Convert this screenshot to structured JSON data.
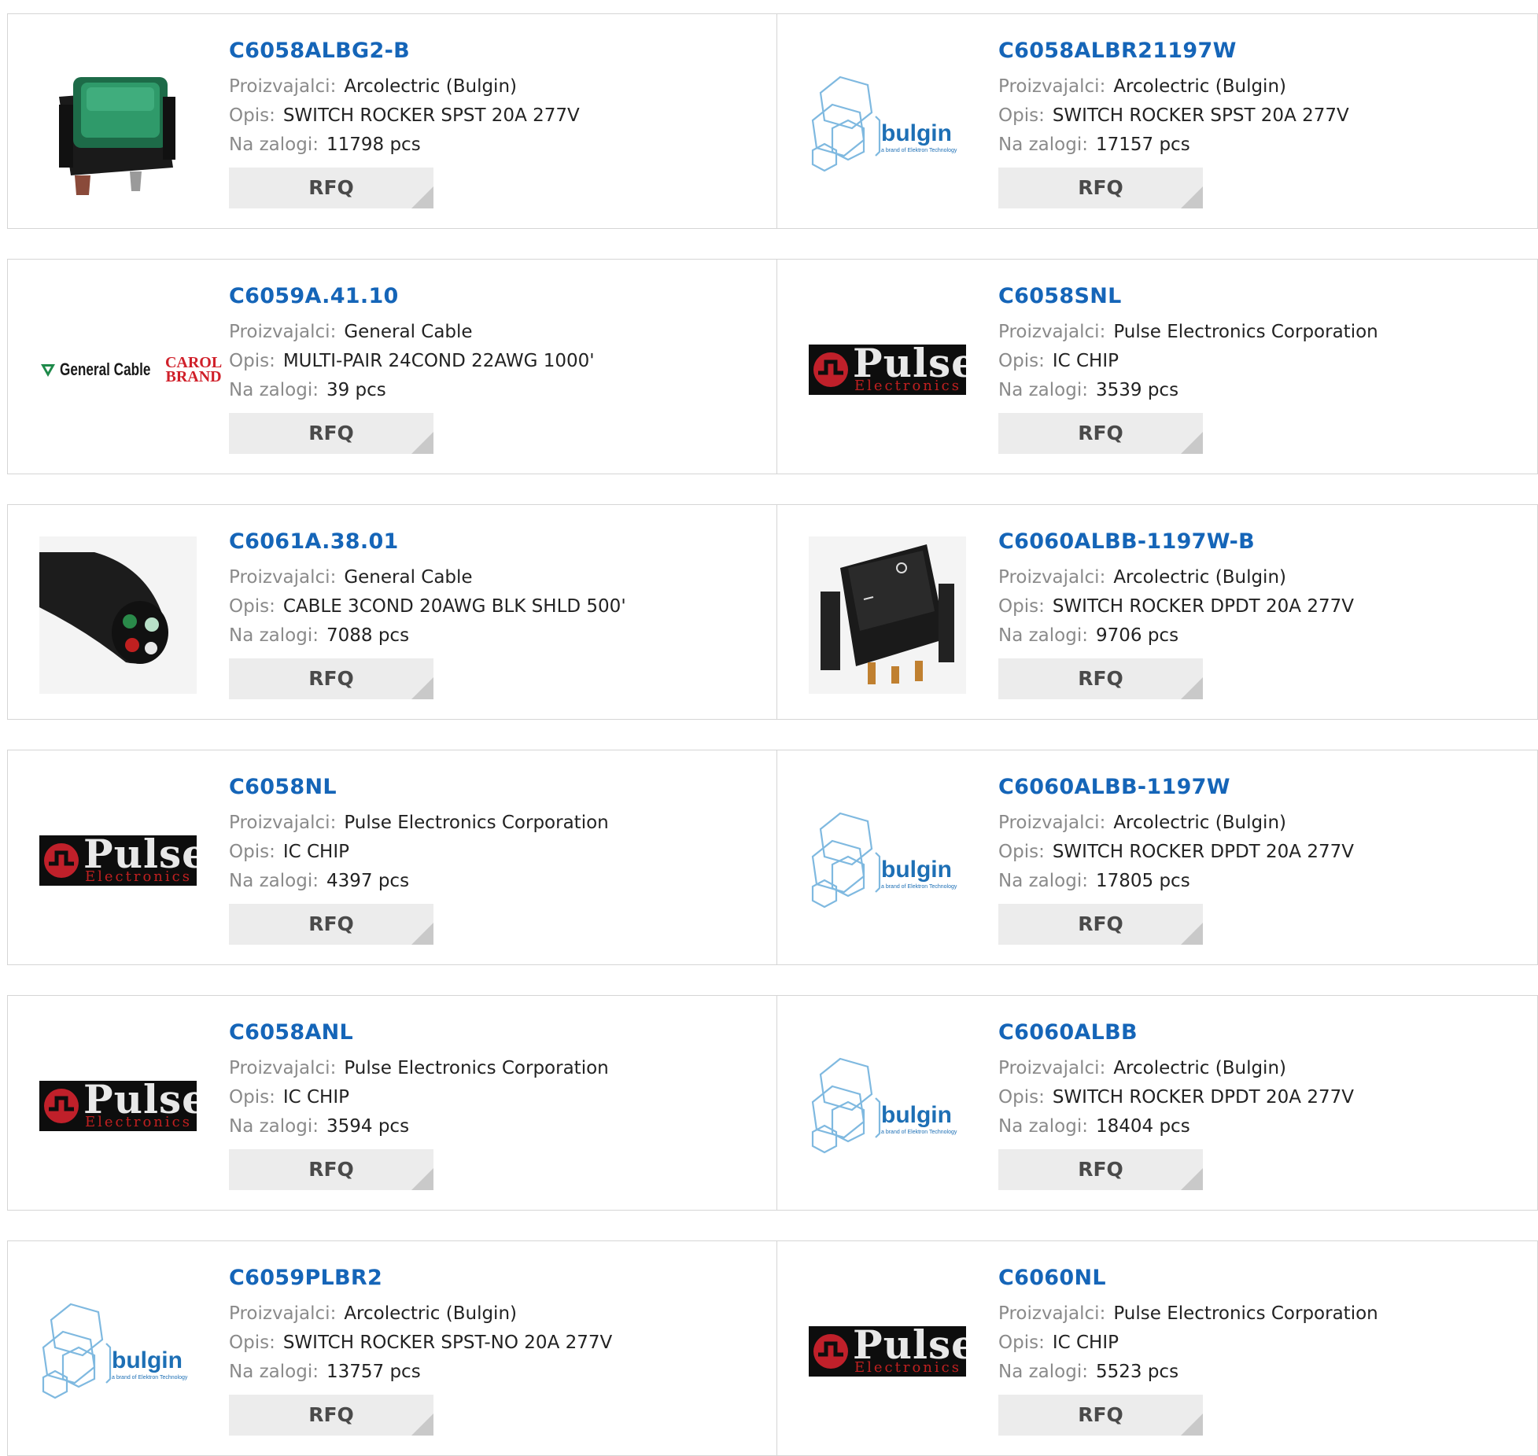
{
  "labels": {
    "manufacturer": "Proizvajalci:",
    "description": "Opis:",
    "stock": "Na zalogi:",
    "rfq": "RFQ"
  },
  "logos": {
    "bulgin": "bulgin",
    "bulgin_tagline": "a brand of Elektron Technology",
    "pulse": "Pulse",
    "pulse_sub": "Electronics",
    "general_cable": "General Cable",
    "carol": "CAROL",
    "carol_brand": "BRAND"
  },
  "products": [
    {
      "part": "C6058ALBG2-B",
      "manufacturer": "Arcolectric (Bulgin)",
      "description": "SWITCH ROCKER SPST 20A 277V",
      "stock": "11798 pcs",
      "image": "green-rocker-switch"
    },
    {
      "part": "C6058ALBR21197W",
      "manufacturer": "Arcolectric (Bulgin)",
      "description": "SWITCH ROCKER SPST 20A 277V",
      "stock": "17157 pcs",
      "image": "bulgin-logo"
    },
    {
      "part": "C6059A.41.10",
      "manufacturer": "General Cable",
      "description": "MULTI-PAIR 24COND 22AWG 1000'",
      "stock": "39 pcs",
      "image": "general-cable-logo"
    },
    {
      "part": "C6058SNL",
      "manufacturer": "Pulse Electronics Corporation",
      "description": "IC CHIP",
      "stock": "3539 pcs",
      "image": "pulse-logo"
    },
    {
      "part": "C6061A.38.01",
      "manufacturer": "General Cable",
      "description": "CABLE 3COND 20AWG BLK SHLD 500'",
      "stock": "7088 pcs",
      "image": "cable-end"
    },
    {
      "part": "C6060ALBB-1197W-B",
      "manufacturer": "Arcolectric (Bulgin)",
      "description": "SWITCH ROCKER DPDT 20A 277V",
      "stock": "9706 pcs",
      "image": "black-rocker-switch"
    },
    {
      "part": "C6058NL",
      "manufacturer": "Pulse Electronics Corporation",
      "description": "IC CHIP",
      "stock": "4397 pcs",
      "image": "pulse-logo"
    },
    {
      "part": "C6060ALBB-1197W",
      "manufacturer": "Arcolectric (Bulgin)",
      "description": "SWITCH ROCKER DPDT 20A 277V",
      "stock": "17805 pcs",
      "image": "bulgin-logo"
    },
    {
      "part": "C6058ANL",
      "manufacturer": "Pulse Electronics Corporation",
      "description": "IC CHIP",
      "stock": "3594 pcs",
      "image": "pulse-logo"
    },
    {
      "part": "C6060ALBB",
      "manufacturer": "Arcolectric (Bulgin)",
      "description": "SWITCH ROCKER DPDT 20A 277V",
      "stock": "18404 pcs",
      "image": "bulgin-logo"
    },
    {
      "part": "C6059PLBR2",
      "manufacturer": "Arcolectric (Bulgin)",
      "description": "SWITCH ROCKER SPST-NO 20A 277V",
      "stock": "13757 pcs",
      "image": "bulgin-logo"
    },
    {
      "part": "C6060NL",
      "manufacturer": "Pulse Electronics Corporation",
      "description": "IC CHIP",
      "stock": "5523 pcs",
      "image": "pulse-logo"
    }
  ]
}
